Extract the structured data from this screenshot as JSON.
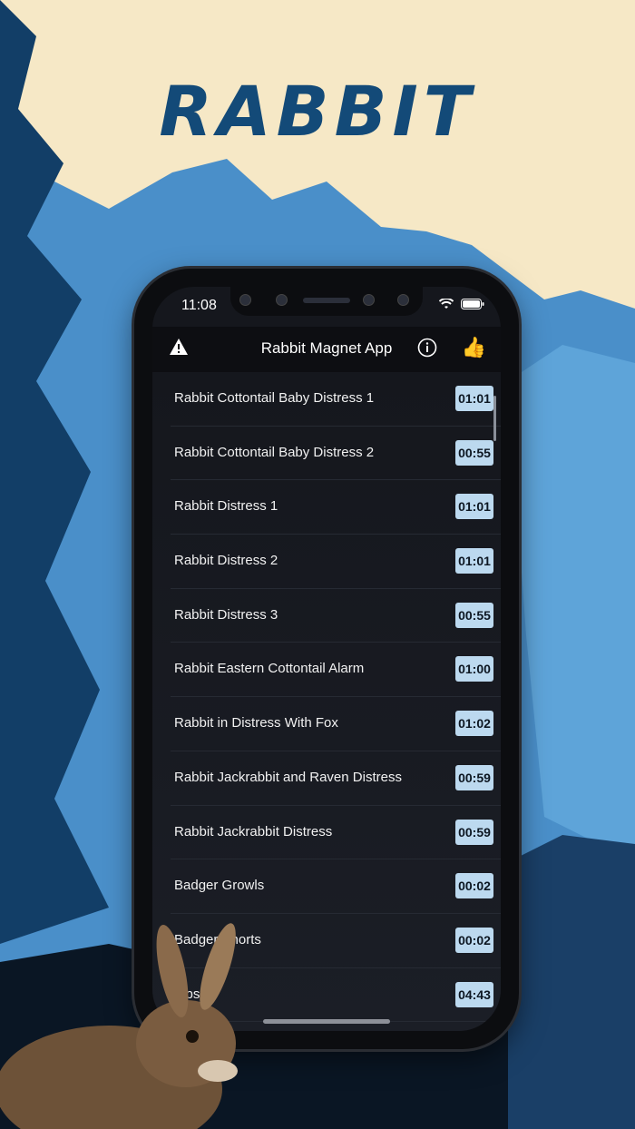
{
  "brand": "RABBIT",
  "status": {
    "time": "11:08"
  },
  "nav": {
    "title": "Rabbit Magnet App"
  },
  "icons": {
    "warning": "warning-icon",
    "info": "info-icon",
    "like": "thumbs-up-icon",
    "wifi": "wifi-icon",
    "battery": "battery-icon"
  },
  "colors": {
    "logo": "#134a78",
    "badge": "#bcd9ef",
    "listBg": "#15171d"
  },
  "sounds": [
    {
      "name": "Rabbit Cottontail Baby Distress 1",
      "duration": "01:01"
    },
    {
      "name": "Rabbit Cottontail Baby Distress 2",
      "duration": "00:55"
    },
    {
      "name": "Rabbit Distress 1",
      "duration": "01:01"
    },
    {
      "name": "Rabbit Distress 2",
      "duration": "01:01"
    },
    {
      "name": "Rabbit Distress 3",
      "duration": "00:55"
    },
    {
      "name": "Rabbit Eastern Cottontail Alarm",
      "duration": "01:00"
    },
    {
      "name": "Rabbit in Distress With Fox",
      "duration": "01:02"
    },
    {
      "name": "Rabbit Jackrabbit and Raven Distress",
      "duration": "00:59"
    },
    {
      "name": "Rabbit Jackrabbit Distress",
      "duration": "00:59"
    },
    {
      "name": "Badger Growls",
      "duration": "00:02"
    },
    {
      "name": "Badger Snorts",
      "duration": "00:02"
    },
    {
      "name": "...ps",
      "duration": "04:43"
    }
  ]
}
